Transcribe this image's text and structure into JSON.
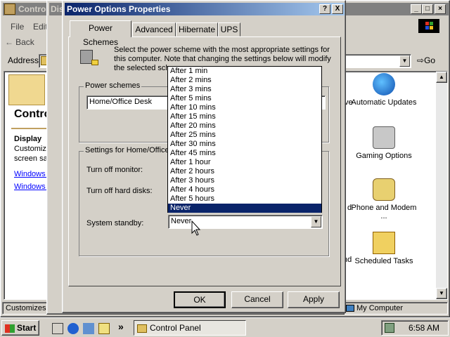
{
  "control_panel": {
    "title": "Control Panel",
    "menu": [
      "File",
      "Edit"
    ],
    "back_label": "Back",
    "address_label": "Address",
    "go_label": "Go",
    "heading": "Control",
    "left_title": "Display",
    "left_desc_1": "Customize",
    "left_desc_2": "screen sa",
    "link_1": "Windows U",
    "link_2": "Windows 2",
    "icons": [
      {
        "label": "Automatic Updates",
        "icon": "globe-icon"
      },
      {
        "label": "Gaming Options",
        "icon": "joystick-icon"
      },
      {
        "label": "Phone and Modem ...",
        "icon": "phone-icon"
      },
      {
        "label": "Scheduled Tasks",
        "icon": "folder-clock-icon"
      }
    ],
    "partial_labels": [
      "ve",
      "d",
      "nd"
    ],
    "status_left": "Customizes y",
    "status_right": "My Computer"
  },
  "behind_dialog_title": "Dis",
  "dialog": {
    "title": "Power Options Properties",
    "tabs": [
      "Power Schemes",
      "Advanced",
      "Hibernate",
      "UPS"
    ],
    "active_tab": 0,
    "description": "Select the power scheme with the most appropriate settings for this computer. Note that changing the settings below will modify the selected sch",
    "schemes_group": "Power schemes",
    "scheme_value": "Home/Office Desk",
    "settings_group": "Settings for Home/Office",
    "turn_off_monitor_label": "Turn off monitor:",
    "turn_off_disks_label": "Turn off hard disks:",
    "standby_label": "System standby:",
    "standby_value": "Never",
    "dropdown_options": [
      "After 1 min",
      "After 2 mins",
      "After 3 mins",
      "After 5 mins",
      "After 10 mins",
      "After 15 mins",
      "After 20 mins",
      "After 25 mins",
      "After 30 mins",
      "After 45 mins",
      "After 1 hour",
      "After 2 hours",
      "After 3 hours",
      "After 4 hours",
      "After 5 hours",
      "Never"
    ],
    "dropdown_selected": "Never",
    "ok_label": "OK",
    "cancel_label": "Cancel",
    "apply_label": "Apply",
    "help_glyph": "?",
    "close_glyph": "X"
  },
  "taskbar": {
    "start_label": "Start",
    "task_label": "Control Panel",
    "clock": "6:58 AM",
    "chevron": "»"
  },
  "colors": {
    "title_active": "#0a246a",
    "title_inactive": "#808080",
    "face": "#d4d0c8",
    "selection": "#0a246a",
    "link": "#0000ff"
  }
}
